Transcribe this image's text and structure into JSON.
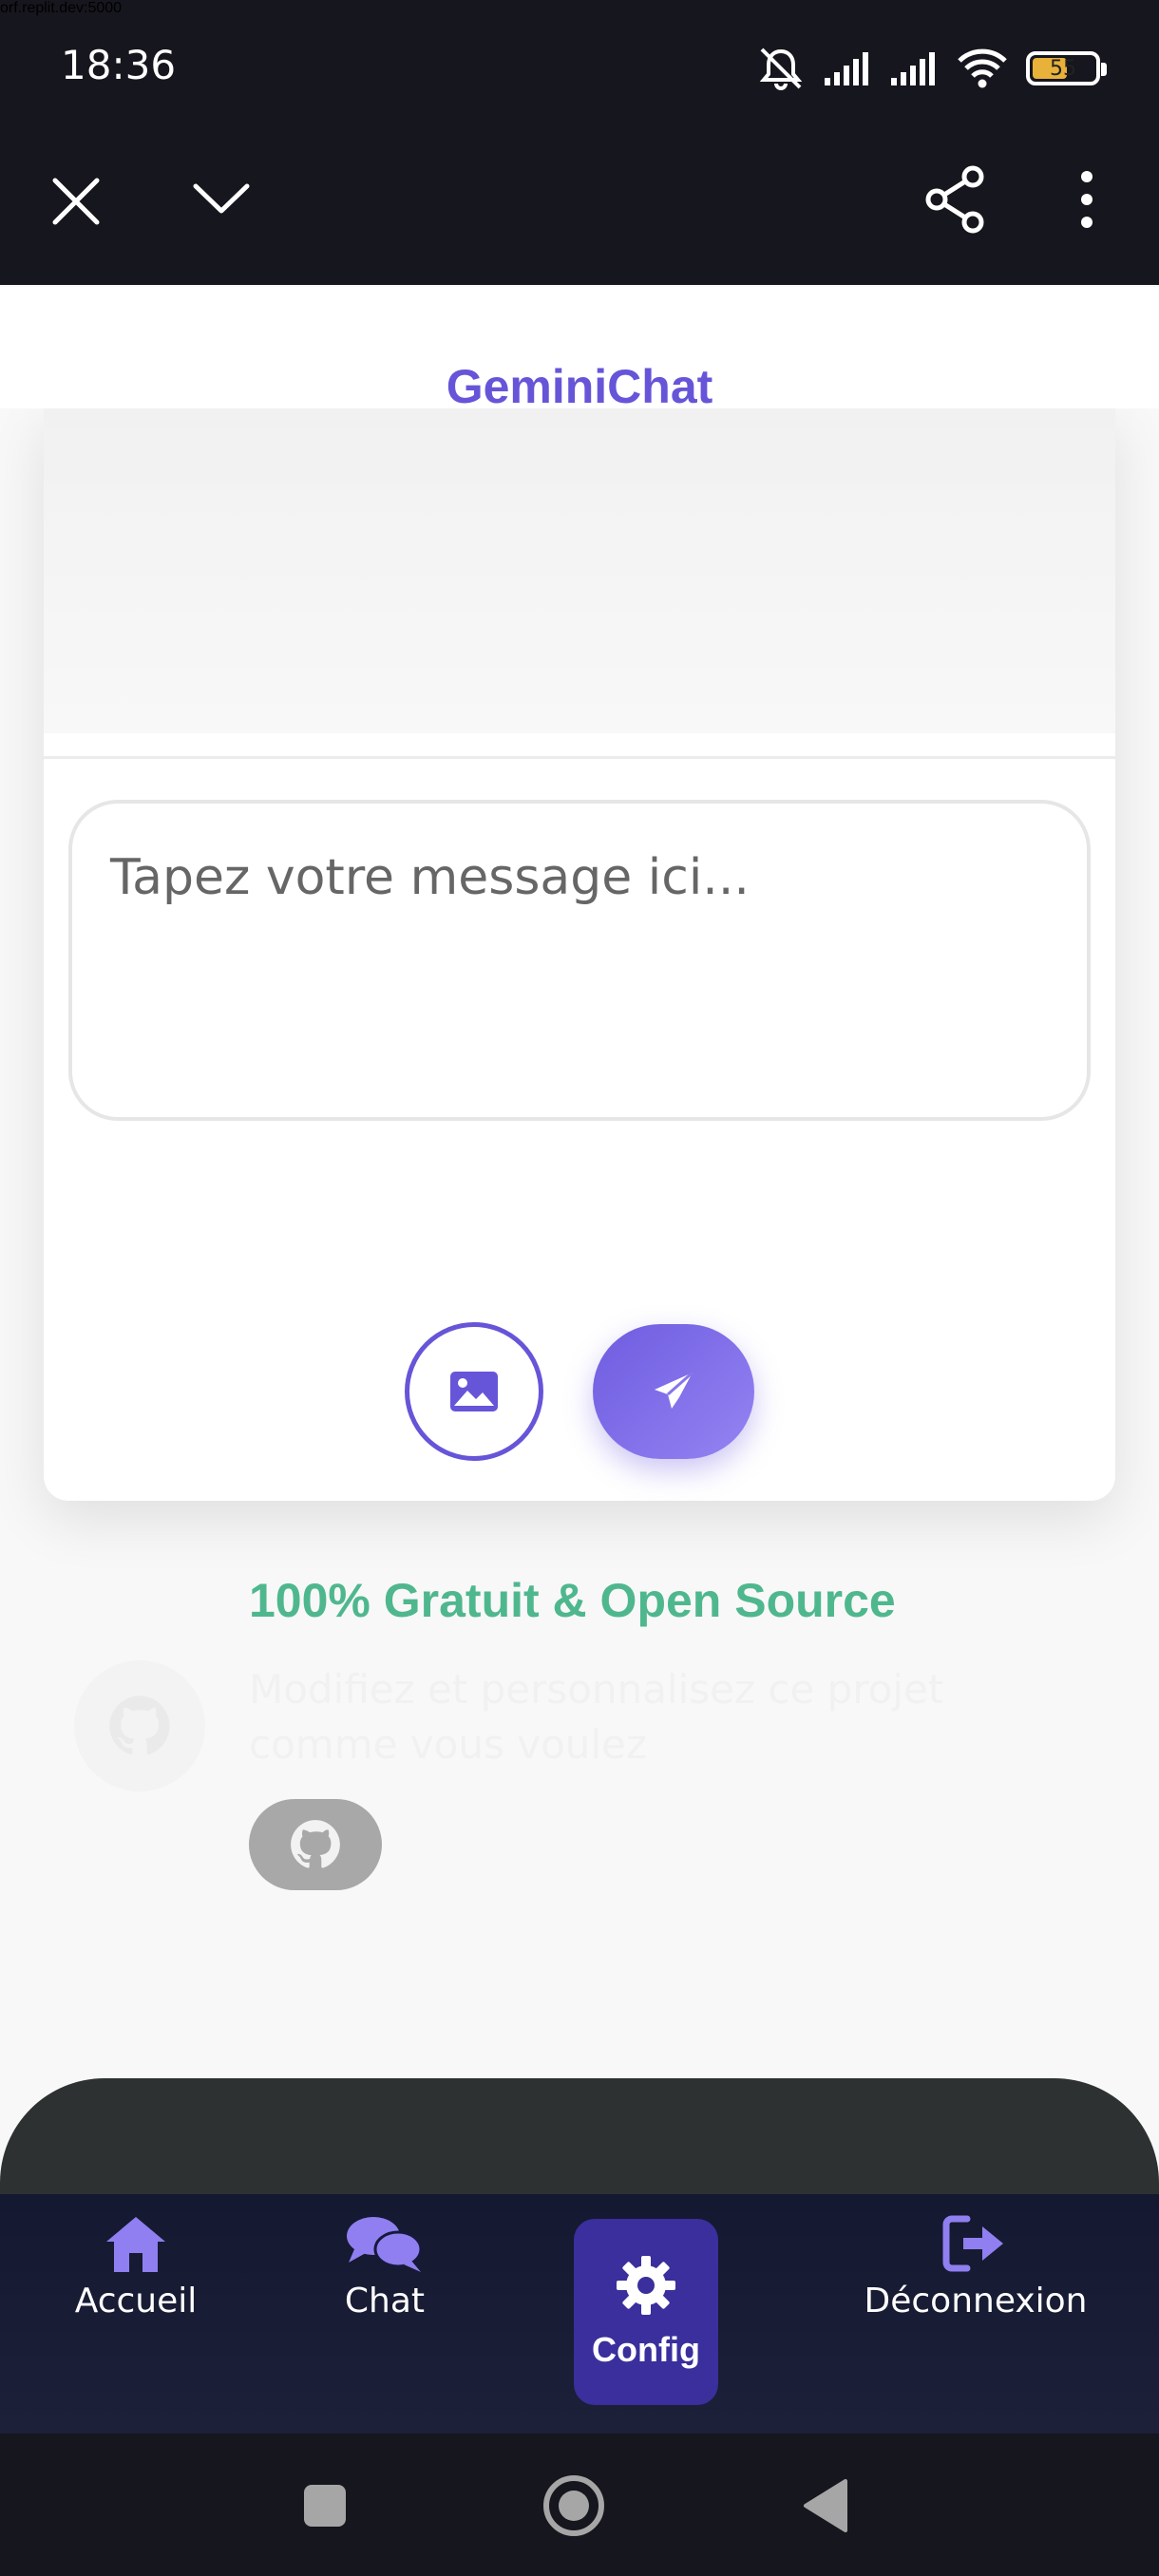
{
  "status_bar": {
    "time": "18:36",
    "battery": "55"
  },
  "browser": {
    "url": "orf.replit.dev:5000"
  },
  "app": {
    "title": "GeminiChat"
  },
  "composer": {
    "placeholder": "Tapez votre message ici..."
  },
  "promo": {
    "title": "100% Gratuit & Open Source",
    "text": "Modifiez et personnalisez ce projet comme vous voulez"
  },
  "nav": {
    "home": "Accueil",
    "chat": "Chat",
    "config": "Config",
    "logout": "Déconnexion"
  },
  "colors": {
    "accent": "#6655d8",
    "green": "#4fb78e",
    "nav_bg": "#141830",
    "active_tab": "#3a2f9c"
  }
}
